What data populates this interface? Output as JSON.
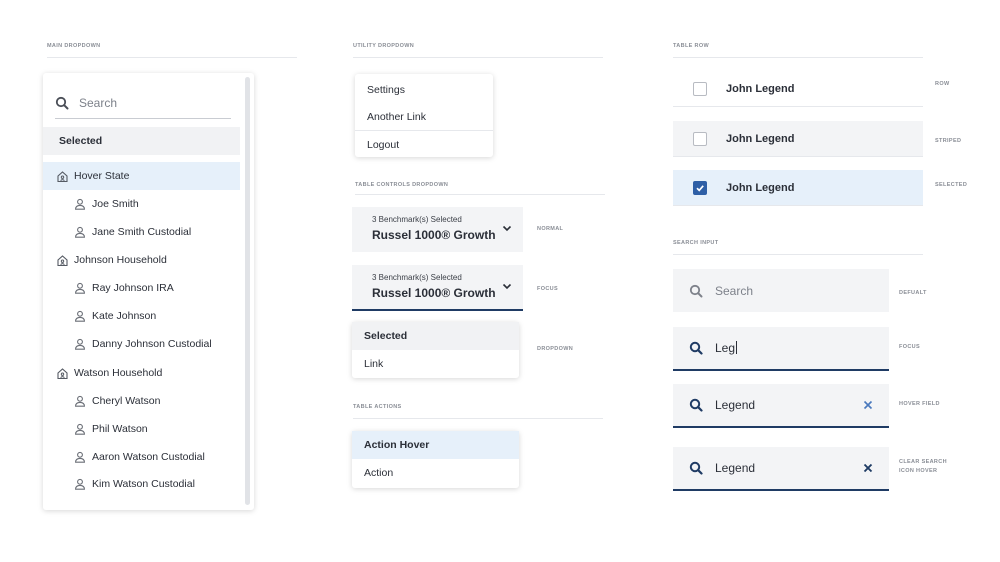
{
  "sections": {
    "main_dropdown": "MAIN DROPDOWN",
    "utility_dropdown": "UTILITY DROPDOWN",
    "table_row": "TABLE ROW",
    "table_controls_dropdown": "TABLE CONTROLS DROPDOWN",
    "search_input": "SEARCH INPUT",
    "table_actions": "TABLE ACTIONS"
  },
  "main_dropdown": {
    "search_placeholder": "Search",
    "selected": "Selected",
    "hover": "Hover State",
    "persons1": [
      "Joe Smith",
      "Jane Smith Custodial"
    ],
    "household2": "Johnson Household",
    "persons2": [
      "Ray Johnson IRA",
      "Kate Johnson",
      "Danny Johnson Custodial"
    ],
    "household3": "Watson Household",
    "persons3": [
      "Cheryl Watson",
      "Phil Watson",
      "Aaron Watson Custodial",
      "Kim Watson Custodial"
    ]
  },
  "utility_dropdown": {
    "items": [
      "Settings",
      "Another Link",
      "Logout"
    ]
  },
  "table_controls": {
    "small": "3 Benchmark(s) Selected",
    "big": "Russel 1000® Growth",
    "label_normal": "NORMAL",
    "label_focus": "FOCUS",
    "label_dropdown": "DROPDOWN",
    "menu": [
      "Selected",
      "Link"
    ]
  },
  "table_actions": {
    "items": [
      "Action Hover",
      "Action"
    ]
  },
  "table_rows": {
    "rows": [
      {
        "name": "John Legend",
        "label": "ROW"
      },
      {
        "name": "John Legend",
        "label": "STRIPED"
      },
      {
        "name": "John Legend",
        "label": "SELECTED"
      }
    ]
  },
  "search_inputs": {
    "default_placeholder": "Search",
    "focus_value": "Leg",
    "hover_value": "Legend",
    "clear_value": "Legend",
    "label_default": "DEFUALT",
    "label_focus": "FOCUS",
    "label_hover": "HOVER FIELD",
    "label_clear_1": "CLEAR SEARCH",
    "label_clear_2": "ICON HOVER"
  },
  "colors": {
    "accent_navy": "#1f3b64",
    "hover_blue": "#e6f0fa",
    "checkbox_blue": "#2e5fa6",
    "field_gray": "#f3f4f6"
  }
}
